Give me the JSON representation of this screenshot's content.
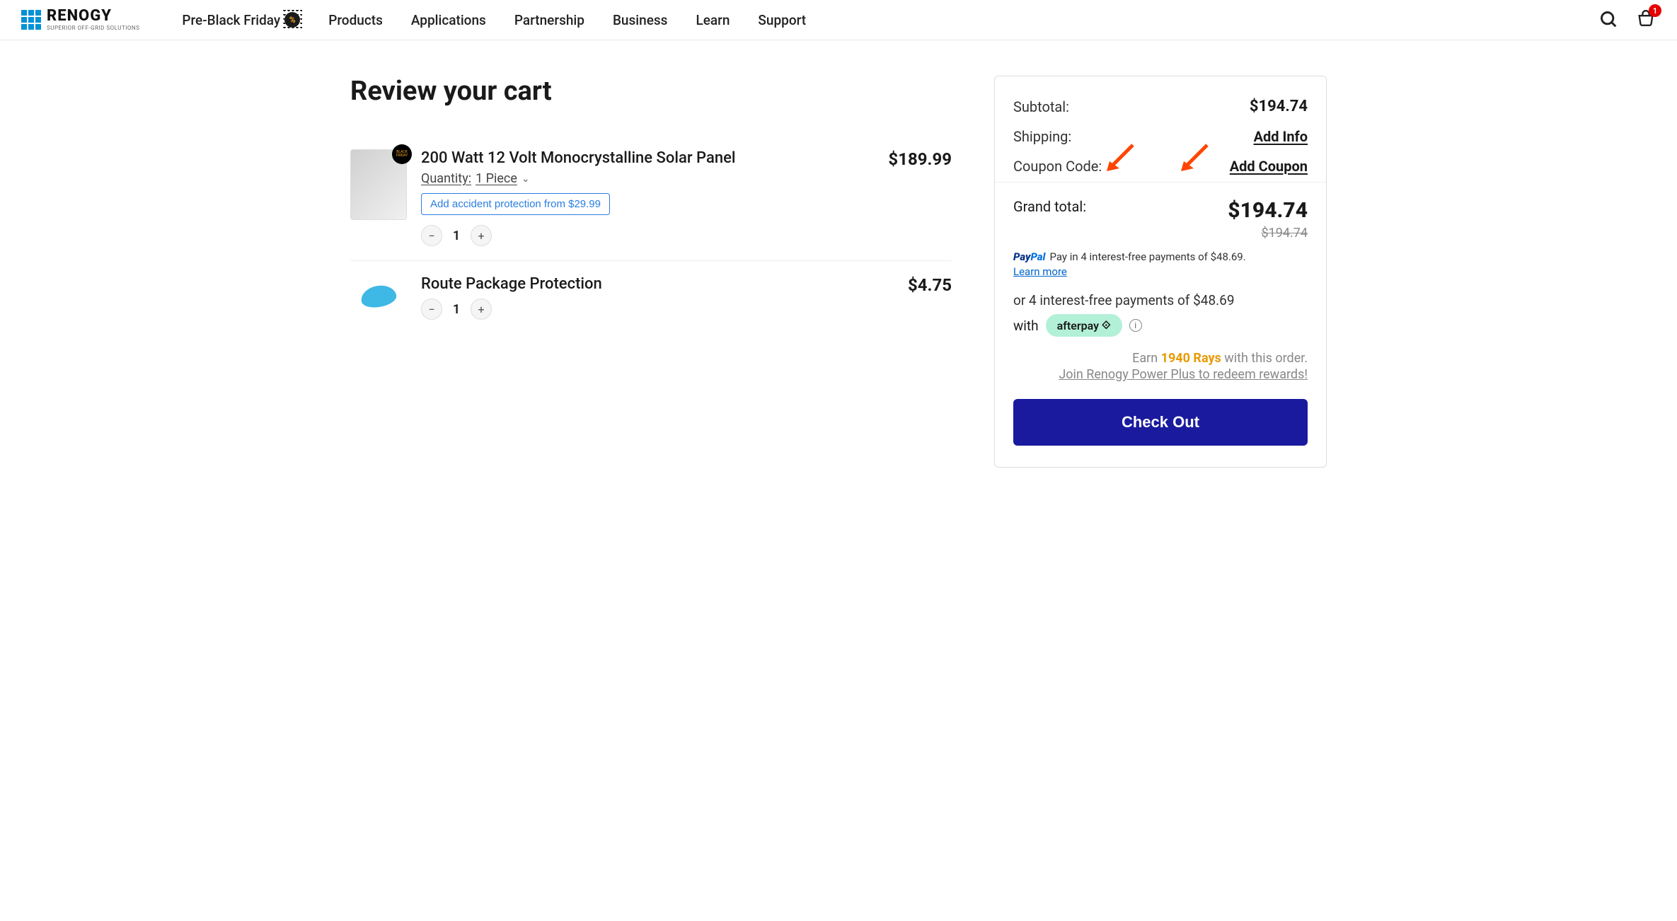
{
  "header": {
    "logo_main": "RENOGY",
    "logo_sub": "SUPERIOR OFF-GRID SOLUTIONS",
    "nav": [
      "Pre-Black Friday",
      "Products",
      "Applications",
      "Partnership",
      "Business",
      "Learn",
      "Support"
    ],
    "cart_count": "1"
  },
  "page_title": "Review your cart",
  "items": [
    {
      "title": "200 Watt 12 Volt Monocrystalline Solar Panel",
      "qty_label": "Quantity:",
      "qty_option": "1 Piece",
      "protection": "Add accident protection from $29.99",
      "qty": "1",
      "price": "$189.99",
      "has_bf_badge": true
    },
    {
      "title": "Route Package Protection",
      "qty": "1",
      "price": "$4.75",
      "is_route": true
    }
  ],
  "summary": {
    "subtotal_label": "Subtotal:",
    "subtotal": "$194.74",
    "shipping_label": "Shipping:",
    "shipping_action": "Add Info",
    "coupon_label": "Coupon Code:",
    "coupon_action": "Add Coupon",
    "grand_label": "Grand total:",
    "grand_total": "$194.74",
    "strike_price": "$194.74",
    "paypal_text": "Pay in 4 interest-free payments of $48.69.",
    "learn_more": "Learn more",
    "afterpay_line1": "or 4 interest-free payments of $48.69",
    "afterpay_with": "with",
    "afterpay_brand": "afterpay",
    "rays_earn": "Earn",
    "rays_amount": "1940 Rays",
    "rays_tail": "with this order.",
    "rays_link": "Join Renogy Power Plus to redeem rewards!",
    "checkout": "Check Out"
  }
}
